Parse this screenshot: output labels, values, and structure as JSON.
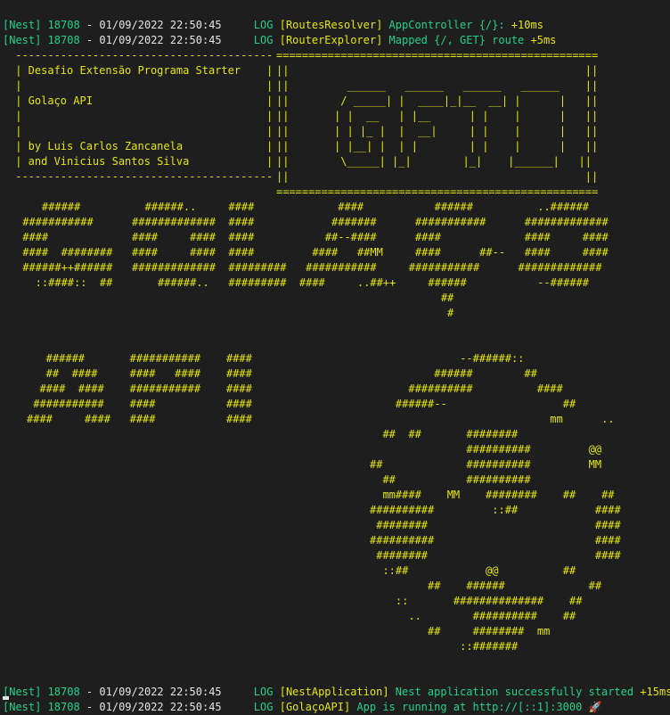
{
  "logs_top": [
    {
      "prefix": "[Nest] 18708",
      "dash": " - ",
      "timestamp": "01/09/2022 22:50:45",
      "level": "LOG",
      "context": "[RoutesResolver]",
      "message": "AppController {/}:",
      "elapsed": "+10ms"
    },
    {
      "prefix": "[Nest] 18708",
      "dash": " - ",
      "timestamp": "01/09/2022 22:50:45",
      "level": "LOG",
      "context": "[RouterExplorer]",
      "message": "Mapped {/, GET} route",
      "elapsed": "+5ms"
    }
  ],
  "credits_box": " ----------------------------------------\n | Desafio Extensão Programa Starter    |\n |                                      |\n | Golaço API                           |\n |                                      |\n |                                      |\n | by Luis Carlos Zancanela             |\n | and Vinicius Santos Silva            |\n ----------------------------------------",
  "logo_box": "==================================================\n||                                              ||\n||         ______   ______   ______   ______    ||\n||        / _____| |  ____|_|__  __| |      |   ||\n||       | |  __   | |__      | |    |      |   ||\n||       | | |_ |  |  __|     | |    |      |   ||\n||       | |__| |  | |        | |    |      |   ||\n||        \\_____| |_|        |_|    |______|   ||\n||                                              ||\n==================================================",
  "banner_golaco": "    ######          ######..     ####             ####           ######          ..######\n ###########      #############  ####            #######      ###########      #############\n ####             ####     ####  ####           ##--####      ####             ####     ####\n ####  ########   ####     ####  ####         ####   ##MM     ####      ##--   ####     ####\n ######++######   #############  #########   ###########     ###########      #############\n   ::####::  ##       ######..   #########  ####     ..##++     ######           --######\n                                                                  ##\n                                                                   #",
  "banner_api": "   ######       ###########    ####\n   ##  ####     ####   ####    ####\n  ####  ####    ###########    ####\n ###########    ####           ####\n####     ####   ####           ####",
  "banner_ball": "              --######::\n          ######        ##\n      ##########          ####\n    ######--                  ##\n                            mm      ..\n  ##  ##       ########\n               ##########         @@\n##             ##########         MM\n  ##           ##########\n  mm####    MM    ########    ##    ##\n##########         ::##            ####\n ########                          ####\n##########                         ####\n ########                          ####\n  ::##            @@          ##\n         ##    ######             ##\n    ::       ##############    ##\n      ..        ##########    ##\n         ##     ########  mm\n              ::#######",
  "logs_bottom": [
    {
      "prefix": "[Nest] 18708",
      "dash": " - ",
      "timestamp": "01/09/2022 22:50:45",
      "level": "LOG",
      "context": "[NestApplication]",
      "message": "Nest application successfully started",
      "elapsed": "+15ms"
    },
    {
      "prefix": "[Nest] 18708",
      "dash": " - ",
      "timestamp": "01/09/2022 22:50:45",
      "level": "LOG",
      "context": "[GolaçoAPI]",
      "message": "App is running at http://[::1]:3000",
      "elapsed": "🚀"
    }
  ],
  "colors": {
    "background": "#1e1e1e",
    "green": "#23d18b",
    "yellow": "#e5e510",
    "white": "#e5e5e5"
  }
}
